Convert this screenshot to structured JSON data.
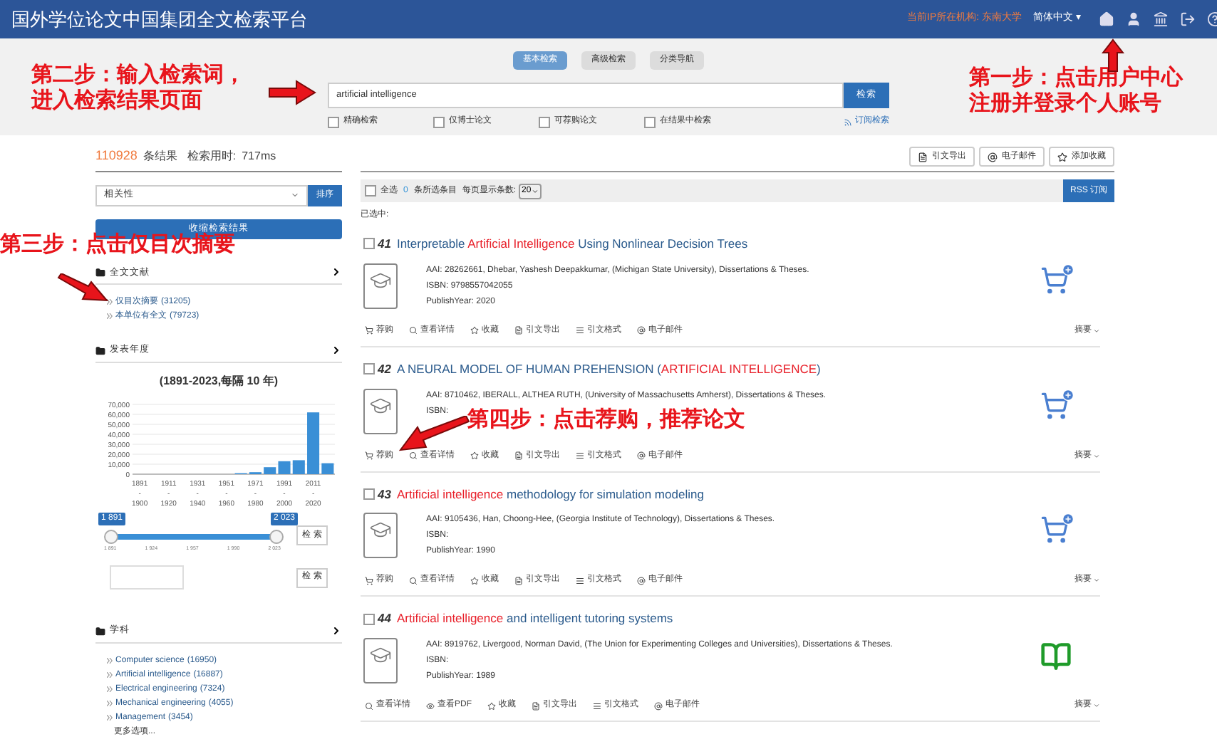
{
  "header": {
    "title": "国外学位论文中国集团全文检索平台",
    "institution": "当前IP所在机构: 东南大学",
    "language": "简体中文 ▾"
  },
  "search": {
    "tabs": [
      {
        "label": "基本检索",
        "selected": true
      },
      {
        "label": "高级检索",
        "selected": false
      },
      {
        "label": "分类导航",
        "selected": false
      }
    ],
    "query": "artificial intelligence",
    "button": "检索",
    "options": [
      {
        "label": "精确检索",
        "checked": false
      },
      {
        "label": "仅博士论文",
        "checked": false
      },
      {
        "label": "可荐购论文",
        "checked": false
      },
      {
        "label": "在结果中检索",
        "checked": false
      }
    ],
    "subscribe": "订阅检索"
  },
  "annotations": [
    {
      "kind": "search",
      "lines": [
        "第二步：输入检索词，",
        "进入检索结果页面"
      ]
    },
    {
      "kind": "account",
      "lines": [
        "第一步：点击用户中心",
        "注册并登录个人账号"
      ]
    },
    {
      "kind": "filter",
      "lines": [
        "第三步：点击仅目次摘要"
      ]
    },
    {
      "kind": "recommend",
      "lines": [
        "第四步：点击荐购，推荐论文"
      ]
    }
  ],
  "summary": {
    "count": "110928",
    "count_label": "条结果",
    "time_label": "检索用时:",
    "time": "717ms"
  },
  "sort": {
    "value": "相关性",
    "button": "排序"
  },
  "collapse_button": "收缩检索结果",
  "facets": [
    {
      "kind": "list",
      "title": "全文文献",
      "items": [
        {
          "label": "仅目次摘要",
          "count": "(31205)"
        },
        {
          "label": "本单位有全文",
          "count": "(79723)"
        }
      ]
    },
    {
      "kind": "year",
      "title": "发表年度",
      "chart_title": "(1891-2023,每隔 10 年)",
      "chart_data": {
        "type": "bar",
        "grid": true,
        "categories": [
          "1891 - 1900",
          null,
          "1911 - 1920",
          null,
          "1931 - 1940",
          null,
          "1951 - 1960",
          null,
          "1971 - 1980",
          null,
          "1991 - 2000",
          null,
          "2011 - 2020",
          null
        ],
        "series": [
          {
            "color": "#3a8fd6",
            "values": [
              0,
              0,
              0,
              0,
              0,
              0,
              0,
              1000,
              2000,
              7000,
              13000,
              14000,
              62000,
              11000
            ]
          }
        ],
        "ylim": [
          0,
          70000
        ],
        "yticks": [
          {
            "value": 0,
            "label": "0"
          },
          {
            "value": 10000,
            "label": "10,000"
          },
          {
            "value": 20000,
            "label": "20,000"
          },
          {
            "value": 30000,
            "label": "30,000"
          },
          {
            "value": 40000,
            "label": "40,000"
          },
          {
            "value": 50000,
            "label": "50,000"
          },
          {
            "value": 60000,
            "label": "60,000"
          },
          {
            "value": 70000,
            "label": "70,000"
          }
        ]
      },
      "slider": {
        "from": "1 891",
        "to": "2 023",
        "level": 1,
        "ticks": [
          "1 891",
          "1 924",
          "1 957",
          "1 990",
          "2 023"
        ],
        "button": "检 索"
      },
      "range_button": "检 索"
    },
    {
      "kind": "list",
      "title": "学科",
      "items": [
        {
          "label": "Computer science",
          "count": "(16950)"
        },
        {
          "label": "Artificial intelligence",
          "count": "(16887)"
        },
        {
          "label": "Electrical engineering",
          "count": "(7324)"
        },
        {
          "label": "Mechanical engineering",
          "count": "(4055)"
        },
        {
          "label": "Management",
          "count": "(3454)"
        }
      ],
      "more": "更多选项..."
    }
  ],
  "toolbar": [
    {
      "kind": "export",
      "label": "引文导出"
    },
    {
      "kind": "email",
      "label": "电子邮件"
    },
    {
      "kind": "favorite",
      "label": "添加收藏"
    }
  ],
  "selection_bar": {
    "all_checked": false,
    "select_all": "全选",
    "selected_count": "0",
    "selected_label": "条所选条目",
    "per_page_label": "每页显示条数:",
    "per_page": "20",
    "rss": "RSS 订阅"
  },
  "selected_label": "已选中:",
  "results": [
    {
      "kind": "cart",
      "checked": false,
      "number": "41",
      "title": [
        {
          "text": "Interpretable ",
          "highlight": false
        },
        {
          "text": "Artificial Intelligence",
          "highlight": true
        },
        {
          "text": " Using Nonlinear Decision Trees",
          "highlight": false
        }
      ],
      "meta": [
        "AAI: 28262661, Dhebar, Yashesh Deepakkumar, (Michigan State University), Dissertations & Theses.",
        "ISBN: 9798557042055",
        "PublishYear: 2020"
      ],
      "actions": [
        {
          "kind": "recommend",
          "label": "荐购"
        },
        {
          "kind": "details",
          "label": "查看详情"
        },
        {
          "kind": "favorite",
          "label": "收藏"
        },
        {
          "kind": "export",
          "label": "引文导出"
        },
        {
          "kind": "format",
          "label": "引文格式"
        },
        {
          "kind": "email",
          "label": "电子邮件"
        }
      ],
      "abstract": "摘要"
    },
    {
      "kind": "cart",
      "checked": false,
      "number": "42",
      "title": [
        {
          "text": "A NEURAL MODEL OF HUMAN PREHENSION (",
          "highlight": false
        },
        {
          "text": "ARTIFICIAL INTELLIGENCE",
          "highlight": true
        },
        {
          "text": ")",
          "highlight": false
        }
      ],
      "meta": [
        "AAI: 8710462, IBERALL, ALTHEA RUTH, (University of Massachusetts Amherst), Dissertations & Theses.",
        "ISBN:"
      ],
      "actions": [
        {
          "kind": "recommend",
          "label": "荐购"
        },
        {
          "kind": "details",
          "label": "查看详情"
        },
        {
          "kind": "favorite",
          "label": "收藏"
        },
        {
          "kind": "export",
          "label": "引文导出"
        },
        {
          "kind": "format",
          "label": "引文格式"
        },
        {
          "kind": "email",
          "label": "电子邮件"
        }
      ],
      "abstract": "摘要"
    },
    {
      "kind": "cart",
      "checked": false,
      "number": "43",
      "title": [
        {
          "text": "Artificial intelligence",
          "highlight": true
        },
        {
          "text": " methodology for simulation modeling",
          "highlight": false
        }
      ],
      "meta": [
        "AAI: 9105436, Han, Choong-Hee, (Georgia Institute of Technology), Dissertations & Theses.",
        "ISBN:",
        "PublishYear: 1990"
      ],
      "actions": [
        {
          "kind": "recommend",
          "label": "荐购"
        },
        {
          "kind": "details",
          "label": "查看详情"
        },
        {
          "kind": "favorite",
          "label": "收藏"
        },
        {
          "kind": "export",
          "label": "引文导出"
        },
        {
          "kind": "format",
          "label": "引文格式"
        },
        {
          "kind": "email",
          "label": "电子邮件"
        }
      ],
      "abstract": "摘要"
    },
    {
      "kind": "fulltext",
      "checked": false,
      "number": "44",
      "title": [
        {
          "text": "Artificial intelligence",
          "highlight": true
        },
        {
          "text": " and intelligent tutoring systems",
          "highlight": false
        }
      ],
      "meta": [
        "AAI: 8919762, Livergood, Norman David, (The Union for Experimenting Colleges and Universities), Dissertations & Theses.",
        "ISBN:",
        "PublishYear: 1989"
      ],
      "actions": [
        {
          "kind": "details",
          "label": "查看详情"
        },
        {
          "kind": "pdf",
          "label": "查看PDF"
        },
        {
          "kind": "favorite",
          "label": "收藏"
        },
        {
          "kind": "export",
          "label": "引文导出"
        },
        {
          "kind": "format",
          "label": "引文格式"
        },
        {
          "kind": "email",
          "label": "电子邮件"
        }
      ],
      "abstract": "摘要"
    }
  ]
}
